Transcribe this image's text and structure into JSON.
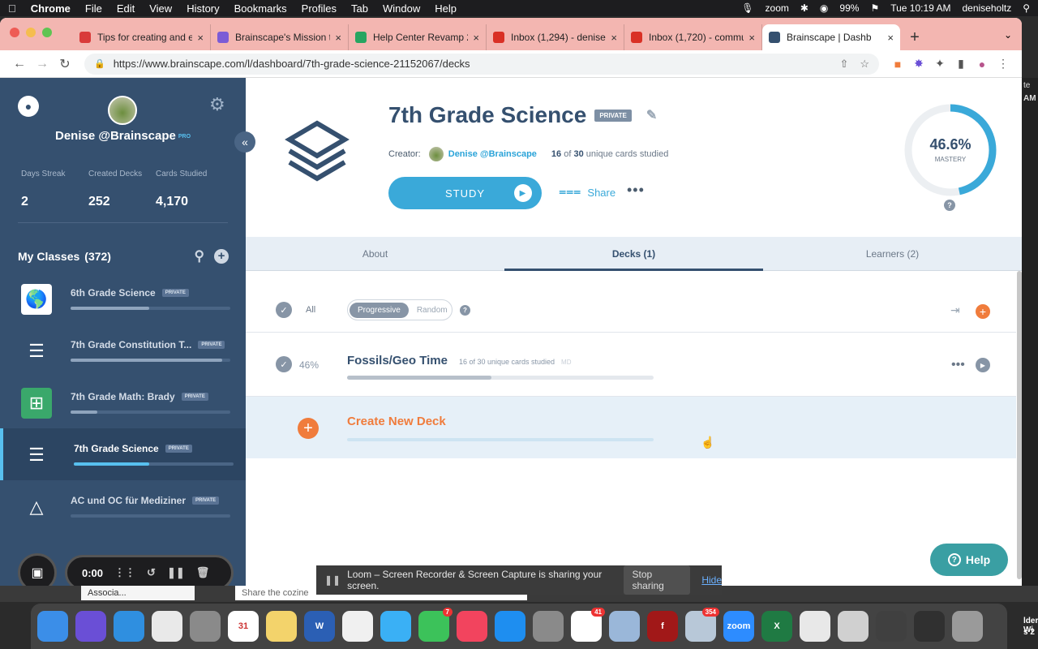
{
  "menubar": {
    "app": "Chrome",
    "items": [
      "File",
      "Edit",
      "View",
      "History",
      "Bookmarks",
      "Profiles",
      "Tab",
      "Window",
      "Help"
    ],
    "zoom": "zoom",
    "battery": "99%",
    "datetime": "Tue 10:19 AM",
    "user": "deniseholtz"
  },
  "tabs": [
    {
      "title": "Tips for creating and e",
      "color": "#d93a3a",
      "icon": "chevron-triangle-icon"
    },
    {
      "title": "Brainscape's Mission to",
      "color": "#7b5cd6",
      "icon": "gear-icon"
    },
    {
      "title": "Help Center Revamp 20",
      "color": "#27a561",
      "icon": "sheets-icon"
    },
    {
      "title": "Inbox (1,294) - denise",
      "color": "#d93025",
      "icon": "gmail-icon"
    },
    {
      "title": "Inbox (1,720) - commu",
      "color": "#d93025",
      "icon": "gmail-icon"
    },
    {
      "title": "Brainscape | Dashb",
      "color": "#35506f",
      "icon": "brainscape-icon",
      "active": true
    }
  ],
  "url": "https://www.brainscape.com/l/dashboard/7th-grade-science-21152067/decks",
  "sidebar": {
    "user_name": "Denise @Brainscape",
    "pro": "PRO",
    "stats": [
      {
        "label": "Days Streak",
        "value": "2"
      },
      {
        "label": "Created Decks",
        "value": "252"
      },
      {
        "label": "Cards Studied",
        "value": "4,170"
      }
    ],
    "classes_title": "My Classes",
    "classes_count": "(372)",
    "classes": [
      {
        "name": "6th Grade Science",
        "tag": "PRIVATE",
        "progress": 0.49,
        "icon": "globe-icon"
      },
      {
        "name": "7th Grade Constitution T...",
        "tag": "PRIVATE",
        "progress": 0.95,
        "icon": "layers-icon"
      },
      {
        "name": "7th Grade Math: Brady",
        "tag": "PRIVATE",
        "progress": 0.17,
        "icon": "calculator-icon"
      },
      {
        "name": "7th Grade Science",
        "tag": "PRIVATE",
        "progress": 0.47,
        "icon": "layers-icon",
        "active": true
      },
      {
        "name": "AC und OC für Mediziner",
        "tag": "PRIVATE",
        "progress": 0.0,
        "icon": "flask-icon"
      }
    ]
  },
  "recorder": {
    "time": "0:00"
  },
  "deck_header": {
    "title": "7th Grade Science",
    "private_tag": "PRIVATE",
    "creator_label": "Creator:",
    "creator_name": "Denise @Brainscape",
    "studied_num": "16",
    "studied_of": "of",
    "studied_total": "30",
    "studied_suffix": "unique cards studied",
    "study_label": "STUDY",
    "share_label": "Share",
    "mastery_pct": "46.6%",
    "mastery_value": 0.466,
    "mastery_label": "MASTERY"
  },
  "content_tabs": [
    {
      "label": "About"
    },
    {
      "label": "Decks (1)",
      "active": true
    },
    {
      "label": "Learners (2)"
    }
  ],
  "deck_controls": {
    "all_label": "All",
    "mode_on": "Progressive",
    "mode_off": "Random"
  },
  "decks": [
    {
      "pct": "46%",
      "name": "Fossils/Geo Time",
      "sub": "16 of 30 unique cards studied",
      "code": "MD",
      "progress": 0.47
    }
  ],
  "create_deck_label": "Create New Deck",
  "help_label": "Help",
  "loom": {
    "message": "Loom – Screen Recorder & Screen Capture is sharing your screen.",
    "stop": "Stop sharing",
    "hide": "Hide"
  },
  "behind": {
    "item1": "Associa...",
    "item2": "Share the cozine"
  },
  "dock_apps": [
    {
      "name": "finder",
      "color": "#3b8ee8",
      "label": ""
    },
    {
      "name": "siri",
      "color": "#6a4fd6",
      "label": ""
    },
    {
      "name": "safari",
      "color": "#2f8fe0",
      "label": ""
    },
    {
      "name": "chrome",
      "color": "#e9e9e9",
      "label": ""
    },
    {
      "name": "launchpad",
      "color": "#8a8a8a",
      "label": ""
    },
    {
      "name": "calendar",
      "color": "#ffffff",
      "label": "31"
    },
    {
      "name": "notes",
      "color": "#f3d36b",
      "label": ""
    },
    {
      "name": "word",
      "color": "#2b5fb4",
      "label": "W"
    },
    {
      "name": "photos",
      "color": "#f0f0f0",
      "label": ""
    },
    {
      "name": "messages",
      "color": "#3ab0f5",
      "label": ""
    },
    {
      "name": "facetime",
      "color": "#3cc25a",
      "label": "",
      "badge": "7"
    },
    {
      "name": "music",
      "color": "#f2445e",
      "label": ""
    },
    {
      "name": "appstore",
      "color": "#1e8ef0",
      "label": ""
    },
    {
      "name": "settings",
      "color": "#8a8a8a",
      "label": ""
    },
    {
      "name": "slack",
      "color": "#ffffff",
      "label": "",
      "badge": "41"
    },
    {
      "name": "preview",
      "color": "#9ab7d9",
      "label": ""
    },
    {
      "name": "flash",
      "color": "#a11818",
      "label": "f"
    },
    {
      "name": "mail",
      "color": "#b8c8d8",
      "label": "",
      "badge": "354"
    },
    {
      "name": "zoom",
      "color": "#2d8cff",
      "label": "zoom"
    },
    {
      "name": "excel",
      "color": "#1f7a43",
      "label": "X"
    },
    {
      "name": "doc1",
      "color": "#e8e8e8",
      "label": ""
    },
    {
      "name": "doc2",
      "color": "#d0d0d0",
      "label": ""
    },
    {
      "name": "doc3",
      "color": "#404040",
      "label": ""
    },
    {
      "name": "doc4",
      "color": "#303030",
      "label": ""
    },
    {
      "name": "trash",
      "color": "#9a9a9a",
      "label": ""
    }
  ],
  "right_edge": {
    "t1": "te",
    "t2": "AM",
    "t3": "lder Wi",
    "t4": "s 2"
  }
}
